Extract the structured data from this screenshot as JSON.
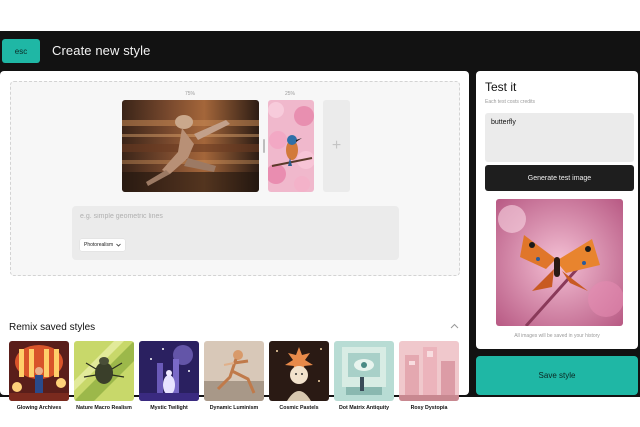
{
  "header": {
    "esc_label": "esc",
    "title": "Create new style"
  },
  "weights": {
    "first": "75%",
    "second": "25%"
  },
  "prompt": {
    "placeholder": "e.g. simple geometric lines",
    "style_value": "Photorealism"
  },
  "remix": {
    "title": "Remix saved styles",
    "styles": [
      {
        "label": "Glowing Archives"
      },
      {
        "label": "Nature Macro Realism"
      },
      {
        "label": "Mystic Twilight"
      },
      {
        "label": "Dynamic Luminism"
      },
      {
        "label": "Cosmic Pastels"
      },
      {
        "label": "Dot Matrix Antiquity"
      },
      {
        "label": "Rosy Dystopia"
      }
    ]
  },
  "test": {
    "title": "Test it",
    "subtitle": "Each test costs credits",
    "input_value": "butterfly",
    "generate_label": "Generate test image",
    "note": "All images will be saved in your history"
  },
  "save_label": "Save style",
  "colors": {
    "accent": "#1fb7a5",
    "dark": "#121212"
  }
}
